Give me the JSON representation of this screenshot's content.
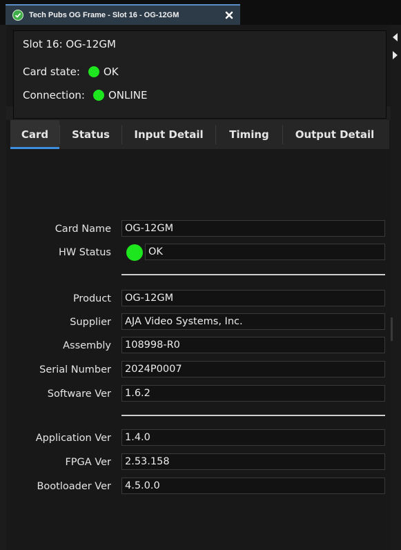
{
  "window_tab": {
    "title": "Tech Pubs OG Frame - Slot 16 - OG-12GM",
    "close_glyph": "✕"
  },
  "summary": {
    "slot": "Slot 16: OG-12GM",
    "card_state_label": "Card state:",
    "card_state_value": "OK",
    "connection_label": "Connection:",
    "connection_value": "ONLINE",
    "status_color": "#1ee61e"
  },
  "card_tabs": [
    {
      "label": "Card",
      "active": true
    },
    {
      "label": "Status",
      "active": false
    },
    {
      "label": "Input Detail",
      "active": false
    },
    {
      "label": "Timing",
      "active": false
    },
    {
      "label": "Output Detail",
      "active": false
    }
  ],
  "card": {
    "card_name": {
      "label": "Card Name",
      "value": "OG-12GM"
    },
    "hw_status": {
      "label": "HW Status",
      "value": "OK"
    },
    "product": {
      "label": "Product",
      "value": "OG-12GM"
    },
    "supplier": {
      "label": "Supplier",
      "value": "AJA Video Systems, Inc."
    },
    "assembly": {
      "label": "Assembly",
      "value": "108998-R0"
    },
    "serial_number": {
      "label": "Serial Number",
      "value": "2024P0007"
    },
    "software_ver": {
      "label": "Software Ver",
      "value": "1.6.2"
    },
    "application_ver": {
      "label": "Application Ver",
      "value": "1.4.0"
    },
    "fpga_ver": {
      "label": "FPGA Ver",
      "value": "2.53.158"
    },
    "bootloader_ver": {
      "label": "Bootloader Ver",
      "value": "4.5.0.0"
    }
  },
  "accent_color": "#3d8fe0"
}
